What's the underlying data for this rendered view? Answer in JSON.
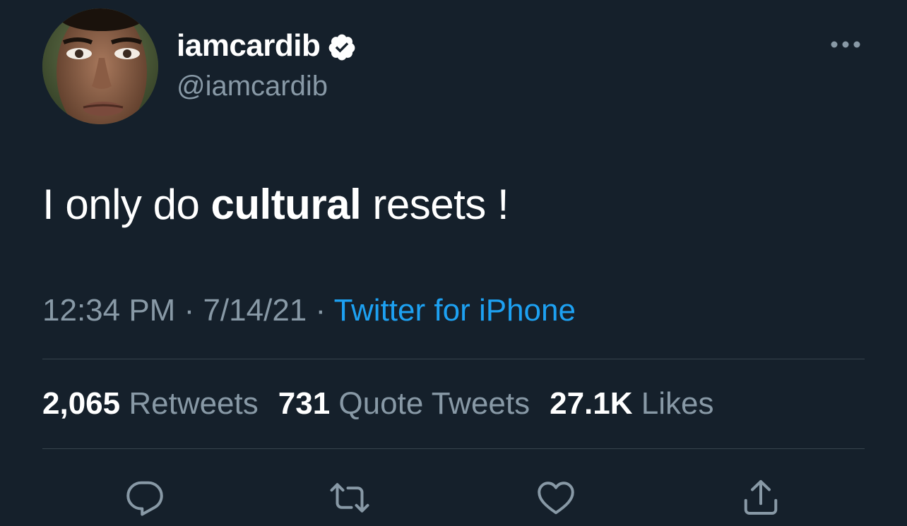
{
  "author": {
    "display_name": "iamcardib",
    "handle": "@iamcardib",
    "verified": true
  },
  "tweet": {
    "text_before": "I only do ",
    "text_bold": "cultural",
    "text_after": " resets !"
  },
  "meta": {
    "time": "12:34 PM",
    "separator1": " · ",
    "date": "7/14/21",
    "separator2": " · ",
    "source": "Twitter for iPhone"
  },
  "stats": {
    "retweets_count": "2,065",
    "retweets_label": "Retweets",
    "quotes_count": "731",
    "quotes_label": "Quote Tweets",
    "likes_count": "27.1K",
    "likes_label": "Likes"
  },
  "actions": {
    "reply": "reply-icon",
    "retweet": "retweet-icon",
    "like": "heart-icon",
    "share": "share-icon"
  },
  "colors": {
    "background": "#15202b",
    "secondary_text": "#8899a6",
    "link": "#1da1f2",
    "divider": "#38444d"
  }
}
